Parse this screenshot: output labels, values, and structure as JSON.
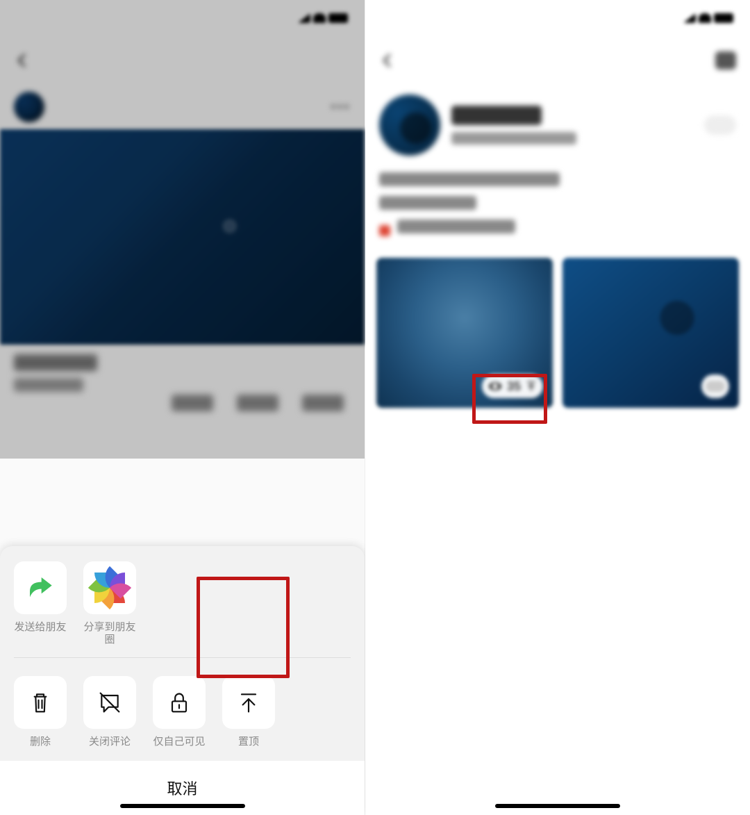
{
  "status_time": "",
  "left": {
    "header_title": "",
    "username": "",
    "share_row": [
      {
        "key": "send_friend",
        "label": "发送给朋友"
      },
      {
        "key": "share_moments",
        "label": "分享到朋友圈"
      }
    ],
    "action_row": [
      {
        "key": "delete",
        "label": "删除"
      },
      {
        "key": "close_comments",
        "label": "关闭评论"
      },
      {
        "key": "only_self",
        "label": "仅自己可见"
      },
      {
        "key": "pin_top",
        "label": "置顶"
      }
    ],
    "cancel": "取消"
  },
  "right": {
    "views_count": "35"
  },
  "highlight_targets": {
    "action": "pin_top",
    "badge": "views-pin"
  },
  "colors": {
    "highlight": "#c01717",
    "share_arrow": "#41c05e"
  }
}
